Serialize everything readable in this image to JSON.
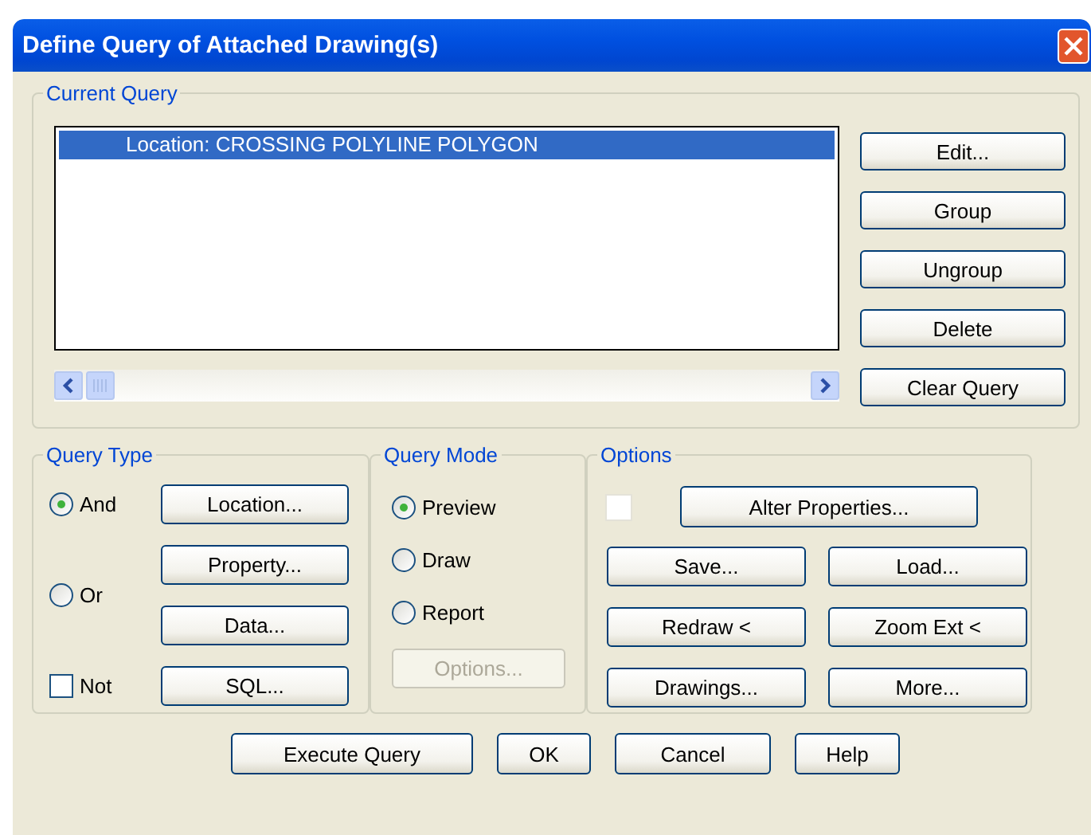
{
  "window": {
    "title": "Define Query of Attached Drawing(s)"
  },
  "current_query": {
    "label": "Current Query",
    "items": [
      {
        "text": "Location: CROSSING POLYLINE POLYGON",
        "selected": true
      }
    ],
    "buttons": [
      "Edit...",
      "Group",
      "Ungroup",
      "Delete",
      "Clear Query"
    ]
  },
  "query_type": {
    "label": "Query Type",
    "options": [
      {
        "label": "And",
        "selected": true
      },
      {
        "label": "Or",
        "selected": false
      }
    ],
    "not_checkbox": {
      "label": "Not",
      "checked": false
    },
    "buttons": [
      "Location...",
      "Property...",
      "Data...",
      "SQL..."
    ]
  },
  "query_mode": {
    "label": "Query Mode",
    "options": [
      {
        "label": "Preview",
        "selected": true
      },
      {
        "label": "Draw",
        "selected": false
      },
      {
        "label": "Report",
        "selected": false
      }
    ],
    "options_button": {
      "label": "Options...",
      "disabled": true
    }
  },
  "options": {
    "label": "Options",
    "alter_checkbox": {
      "checked": false
    },
    "alter_button": "Alter Properties...",
    "buttons": [
      "Save...",
      "Load...",
      "Redraw <",
      "Zoom Ext <",
      "Drawings...",
      "More..."
    ]
  },
  "footer_buttons": [
    "Execute Query",
    "OK",
    "Cancel",
    "Help"
  ]
}
